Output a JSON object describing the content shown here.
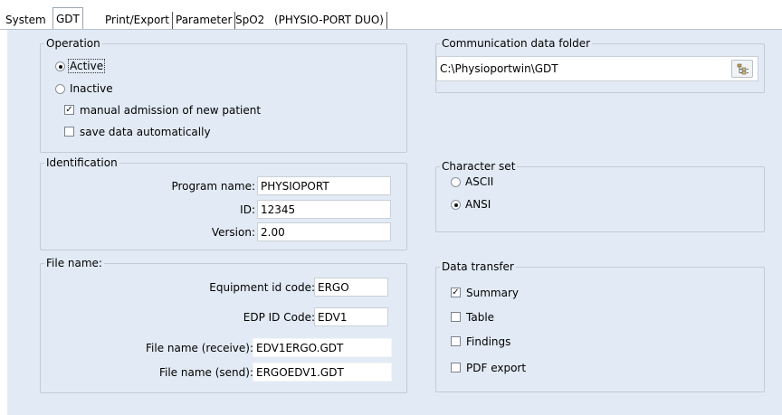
{
  "tabs": [
    {
      "label": "System"
    },
    {
      "label": "GDT"
    },
    {
      "label": "Print/Export"
    },
    {
      "label": "Parameter"
    },
    {
      "label": "SpO2"
    },
    {
      "label": "(PHYSIO-PORT DUO)"
    }
  ],
  "active_tab": "GDT",
  "operation": {
    "legend": "Operation",
    "active_label": "Active",
    "inactive_label": "Inactive",
    "selected": "Active",
    "manual_admission_label": "manual admission of new patient",
    "manual_admission_checked": true,
    "save_auto_label": "save data automatically",
    "save_auto_checked": false
  },
  "identification": {
    "legend": "Identification",
    "program_name_label": "Program name:",
    "program_name_value": "PHYSIOPORT",
    "id_label": "ID:",
    "id_value": "12345",
    "version_label": "Version:",
    "version_value": "2.00"
  },
  "file_name": {
    "legend": "File name:",
    "equipment_label": "Equipment id code:",
    "equipment_value": "ERGO",
    "edp_label": "EDP ID Code:",
    "edp_value": "EDV1",
    "receive_label": "File name (receive):",
    "receive_value": "EDV1ERGO.GDT",
    "send_label": "File name (send):",
    "send_value": "ERGOEDV1.GDT"
  },
  "communication": {
    "legend": "Communication data folder",
    "path_value": "C:\\Physioportwin\\GDT",
    "browse_icon": "folder-tree-icon"
  },
  "charset": {
    "legend": "Character set",
    "ascii_label": "ASCII",
    "ansi_label": "ANSI",
    "selected": "ANSI"
  },
  "data_transfer": {
    "legend": "Data transfer",
    "summary_label": "Summary",
    "summary_checked": true,
    "table_label": "Table",
    "table_checked": false,
    "findings_label": "Findings",
    "findings_checked": false,
    "pdf_label": "PDF export",
    "pdf_checked": false
  },
  "colors": {
    "panel_bg": "#e2ebf5",
    "group_border": "#c2cbd6"
  }
}
